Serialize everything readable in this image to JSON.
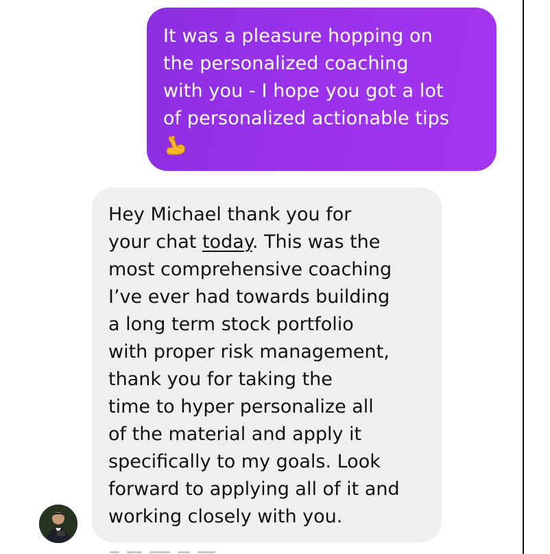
{
  "conversation": {
    "messages": [
      {
        "direction": "outgoing",
        "lines": [
          "It was a pleasure hopping on",
          "the personalized coaching",
          "with you - I hope you got a lot",
          "of personalized actionable tips"
        ],
        "emoji": "flexed-biceps-icon"
      },
      {
        "direction": "incoming",
        "lines": [
          "Hey Michael thank you for",
          "your chat ",
          "today",
          ". This was the",
          "most comprehensive coaching",
          "I’ve ever had towards building",
          "a long term stock portfolio",
          "with proper risk management,",
          "thank you for taking the",
          "time to hyper personalize all",
          "of the material and apply it",
          "specifically to my goals. Look",
          "forward to applying all of it and",
          "working closely with you."
        ]
      }
    ]
  },
  "colors": {
    "outgoing_bubble": "#9a32ea",
    "incoming_bubble": "#efefef",
    "incoming_text": "#111111",
    "outgoing_text": "#ffffff"
  }
}
